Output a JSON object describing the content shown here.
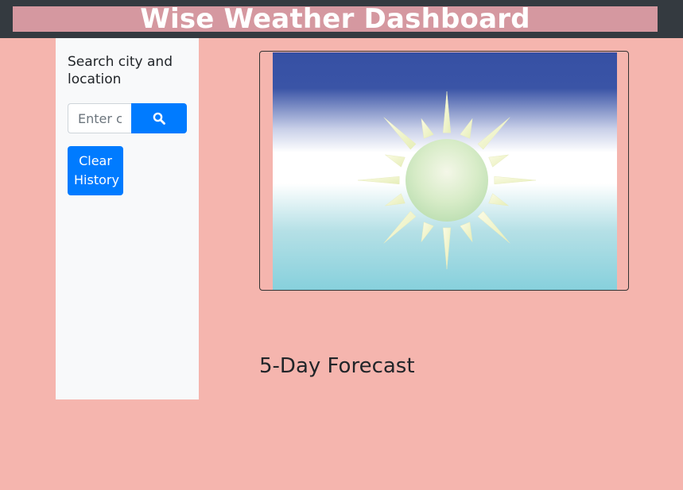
{
  "header": {
    "title": "Wise Weather Dashboard"
  },
  "sidebar": {
    "search_label": "Search city and location",
    "search_placeholder": "Enter city",
    "search_button_icon": "search-icon",
    "clear_history_label": "Clear History"
  },
  "main": {
    "weather_image_icon": "sun-icon",
    "forecast_heading": "5-Day Forecast"
  },
  "colors": {
    "page_background": "#f5b5ae",
    "topbar": "#343a40",
    "title_background": "#d598a0",
    "sidebar_background": "#f8f9fa",
    "primary_button": "#007bff"
  }
}
